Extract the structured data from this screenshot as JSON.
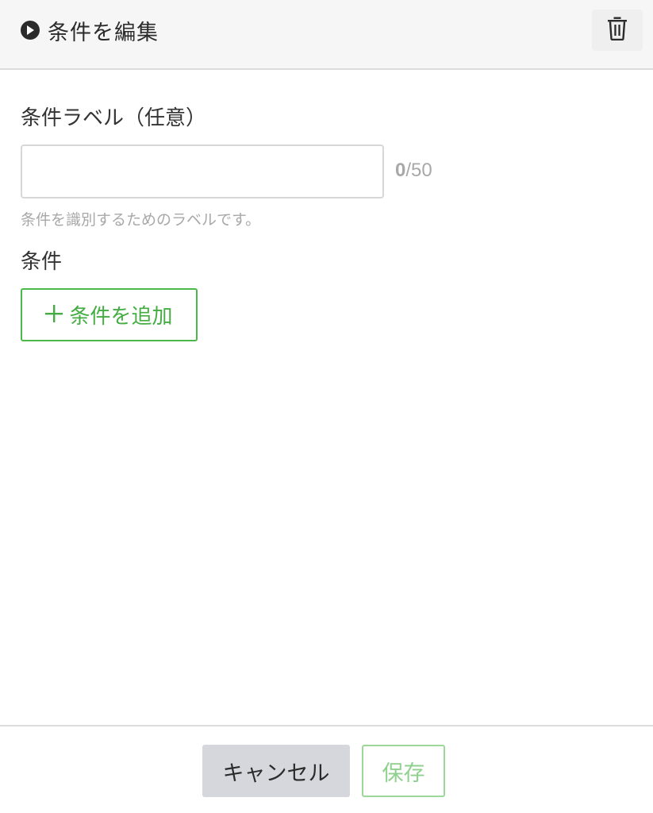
{
  "header": {
    "title": "条件を編集",
    "title_icon": "play-circle-icon",
    "delete_icon": "trash-icon"
  },
  "form": {
    "label_heading": "条件ラベル（任意）",
    "label_input": {
      "value": "",
      "placeholder": ""
    },
    "counter": {
      "current": "0",
      "max": "/50"
    },
    "help_text": "条件を識別するためのラベルです。",
    "conditions_heading": "条件",
    "add_condition_label": "条件を追加",
    "add_condition_icon": "plus-icon"
  },
  "footer": {
    "cancel_label": "キャンセル",
    "save_label": "保存"
  },
  "colors": {
    "accent_green": "#4cb84a",
    "save_disabled_green": "#9bd89a",
    "header_bg": "#f6f6f6",
    "cancel_bg": "#d6d7dc",
    "muted_text": "#a8a8a8"
  }
}
